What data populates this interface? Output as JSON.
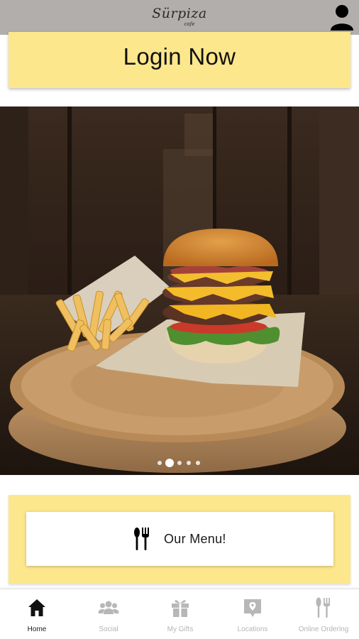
{
  "header": {
    "logo_text": "Sürpiza",
    "logo_subtext": "cafe",
    "profile_icon": "user-icon"
  },
  "login": {
    "label": "Login Now"
  },
  "carousel": {
    "slide_count": 5,
    "active_index": 1,
    "slide_subject": "burger-and-fries"
  },
  "menu": {
    "label": "Our Menu!",
    "icon": "utensils-icon"
  },
  "bottom_nav": {
    "items": [
      {
        "label": "Home",
        "icon": "home-icon",
        "active": true
      },
      {
        "label": "Social",
        "icon": "people-icon",
        "active": false
      },
      {
        "label": "My Gifts",
        "icon": "gift-icon",
        "active": false
      },
      {
        "label": "Locations",
        "icon": "map-pin-icon",
        "active": false
      },
      {
        "label": "Online Ordering",
        "icon": "utensils-icon",
        "active": false
      }
    ]
  },
  "colors": {
    "header_bg": "#b1aeab",
    "accent_yellow": "#fde78d",
    "nav_active": "#1a1a1a",
    "nav_inactive": "#b4b4b4"
  }
}
